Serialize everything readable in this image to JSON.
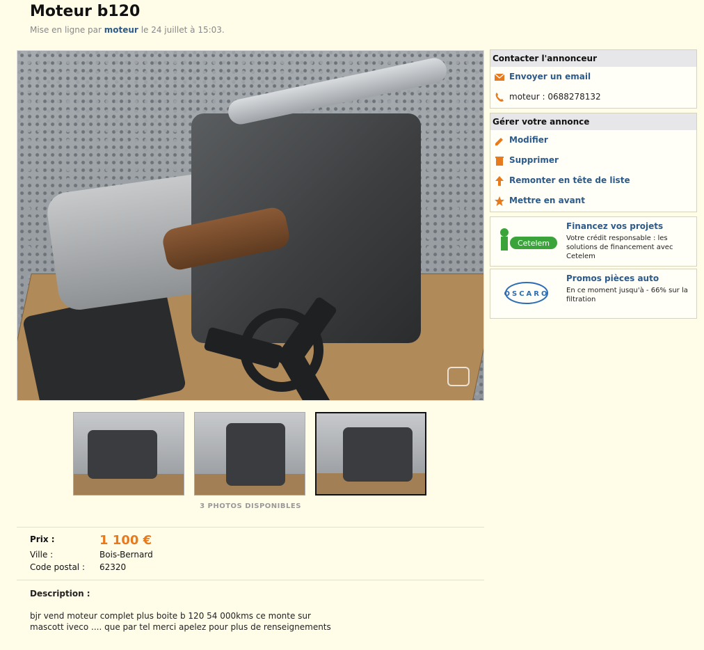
{
  "listing": {
    "title": "Moteur b120",
    "meta_prefix": "Mise en ligne par",
    "author": "moteur",
    "meta_suffix": "le 24 juillet à 15:03."
  },
  "gallery": {
    "photos_count": "3 PHOTOS DISPONIBLES",
    "active_thumb_index": 2
  },
  "details": {
    "price_label": "Prix :",
    "price_value": "1 100 €",
    "city_label": "Ville :",
    "city_value": "Bois-Bernard",
    "postal_label": "Code postal :",
    "postal_value": "62320",
    "description_label": "Description :",
    "description_text": "bjr vend moteur complet plus boite b 120 54 000kms ce monte sur mascott iveco .... que par tel merci apelez pour plus de renseignements"
  },
  "contact": {
    "title": "Contacter l'annonceur",
    "email_label": "Envoyer un email",
    "phone_label": "moteur : 0688278132"
  },
  "manage": {
    "title": "Gérer votre annonce",
    "items": [
      "Modifier",
      "Supprimer",
      "Remonter en tête de liste",
      "Mettre en avant"
    ]
  },
  "ads": [
    {
      "logo": "Cetelem",
      "title": "Financez vos projets",
      "text": "Votre crédit responsable : les solutions de financement avec Cetelem"
    },
    {
      "logo": "OSCARO",
      "title": "Promos pièces auto",
      "text": "En ce moment jusqu'à - 66% sur la filtration"
    }
  ],
  "colors": {
    "background": "#fffde8",
    "link": "#2c5a8a",
    "price": "#e87a1e",
    "icon_orange": "#e87a1e"
  }
}
